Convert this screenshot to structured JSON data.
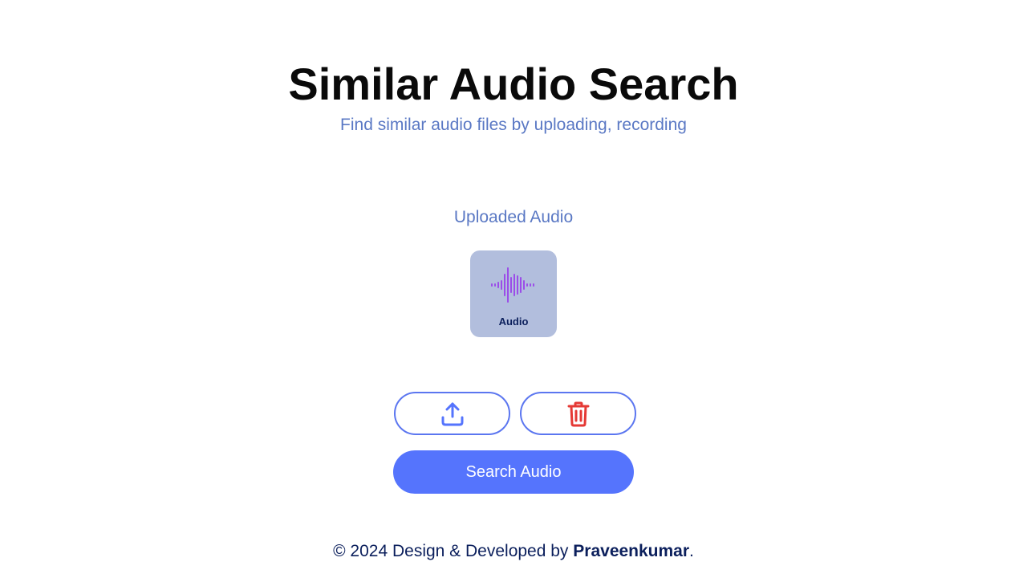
{
  "header": {
    "title": "Similar Audio Search",
    "subtitle": "Find similar audio files by uploading, recording"
  },
  "uploaded": {
    "section_label": "Uploaded Audio",
    "tile_label": "Audio",
    "tile_icon": "audio-waveform-icon"
  },
  "actions": {
    "upload_icon": "upload-icon",
    "delete_icon": "trash-icon",
    "search_label": "Search Audio"
  },
  "footer": {
    "prefix": "© 2024 Design & Developed by ",
    "author": "Praveenkumar",
    "suffix": "."
  },
  "colors": {
    "accent": "#5574fd",
    "subtitle": "#5a78c4",
    "tile_bg": "#b2bedd",
    "waveform": "#9b4de8",
    "delete": "#e53935",
    "footer_text": "#0b1f5c"
  }
}
